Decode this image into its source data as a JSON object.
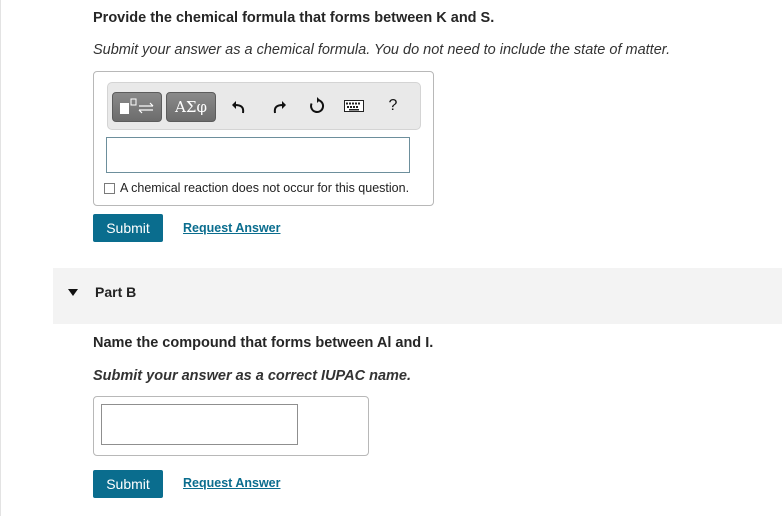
{
  "part_a": {
    "question": "Provide the chemical formula that forms between K and S.",
    "instruction": "Submit your answer as a chemical formula. You do not need to include the state of matter.",
    "toolbar": {
      "greek_label": "ΑΣφ",
      "help_label": "?"
    },
    "answer_value": "",
    "no_reaction_label": "A chemical reaction does not occur for this question.",
    "submit_label": "Submit",
    "request_label": "Request Answer"
  },
  "part_b": {
    "title": "Part B",
    "question": "Name the compound that forms between Al and I.",
    "instruction": "Submit your answer as a correct IUPAC name.",
    "answer_value": "",
    "submit_label": "Submit",
    "request_label": "Request Answer"
  },
  "colors": {
    "accent": "#0a6d8e",
    "part_bar_bg": "#f3f3f3"
  }
}
